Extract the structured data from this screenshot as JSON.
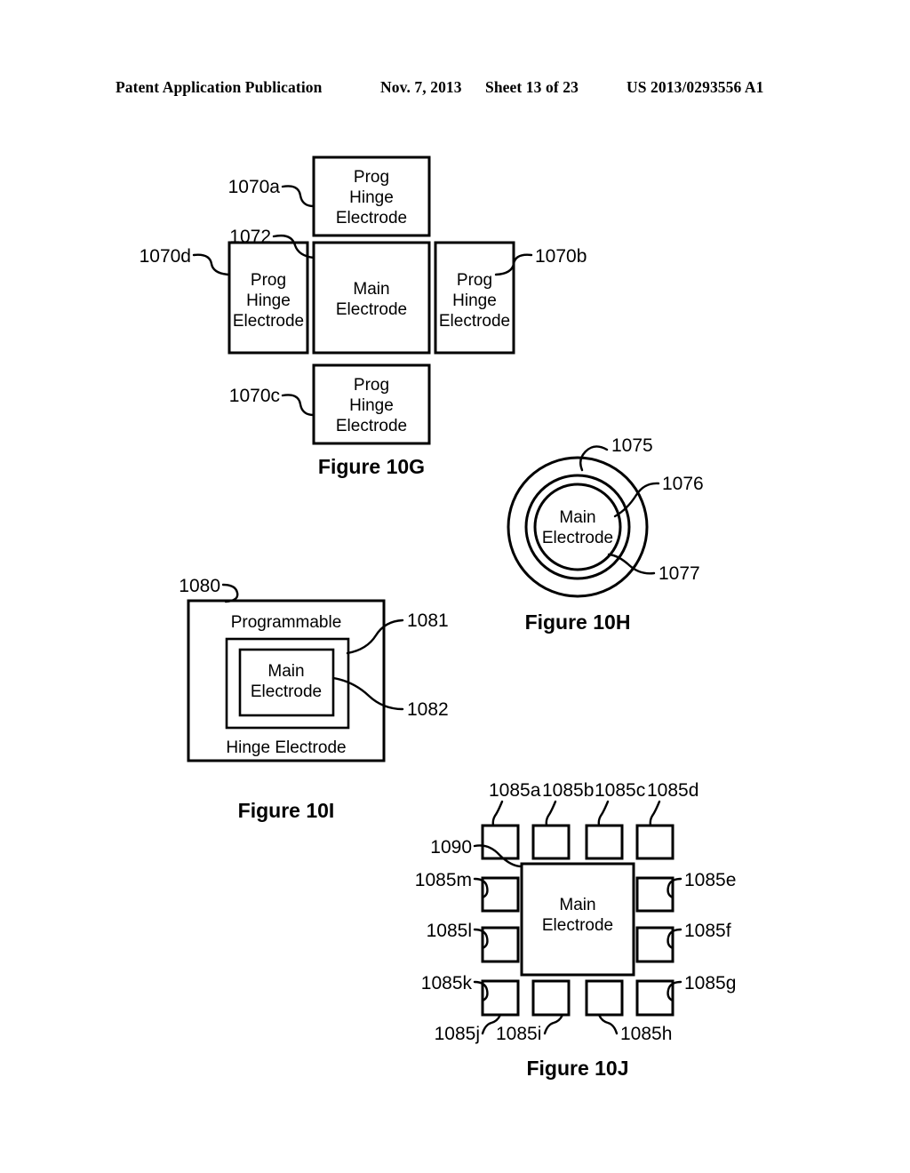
{
  "header": {
    "publication": "Patent Application Publication",
    "date": "Nov. 7, 2013",
    "sheet": "Sheet 13 of 23",
    "number": "US 2013/0293556 A1"
  },
  "figures": [
    {
      "caption": "Figure 10G",
      "boxes": [
        {
          "ref": "1070a",
          "lines": [
            "Prog",
            "Hinge",
            "Electrode"
          ],
          "position": "top"
        },
        {
          "ref": "1070d",
          "lines": [
            "Prog",
            "Hinge",
            "Electrode"
          ],
          "position": "left"
        },
        {
          "ref": "1072",
          "lines": [
            "Main",
            "Electrode"
          ],
          "position": "center"
        },
        {
          "ref": "1070b",
          "lines": [
            "Prog",
            "Hinge",
            "Electrode"
          ],
          "position": "right"
        },
        {
          "ref": "1070c",
          "lines": [
            "Prog",
            "Hinge",
            "Electrode"
          ],
          "position": "bottom"
        }
      ],
      "labels": [
        "1070a",
        "1072",
        "1070d",
        "1070b",
        "1070c"
      ]
    },
    {
      "caption": "Figure 10H",
      "center_text": [
        "Main",
        "Electrode"
      ],
      "labels": [
        "1075",
        "1076",
        "1077"
      ]
    },
    {
      "caption": "Figure 10I",
      "outer_top_text": "Programmable",
      "outer_bottom_text": "Hinge Electrode",
      "center_text": [
        "Main",
        "Electrode"
      ],
      "labels": [
        "1080",
        "1081",
        "1082"
      ]
    },
    {
      "caption": "Figure 10J",
      "center_text": [
        "Main",
        "Electrode"
      ],
      "labels": [
        "1085a",
        "1085b",
        "1085c",
        "1085d",
        "1090",
        "1085m",
        "1085l",
        "1085k",
        "1085e",
        "1085f",
        "1085g",
        "1085j",
        "1085i",
        "1085h"
      ]
    }
  ],
  "text_common": {
    "prog": "Prog",
    "hinge": "Hinge",
    "electrode": "Electrode",
    "main": "Main",
    "programmable": "Programmable",
    "hinge_electrode": "Hinge Electrode"
  },
  "colors": {
    "ink": "#000000",
    "paper": "#ffffff"
  }
}
